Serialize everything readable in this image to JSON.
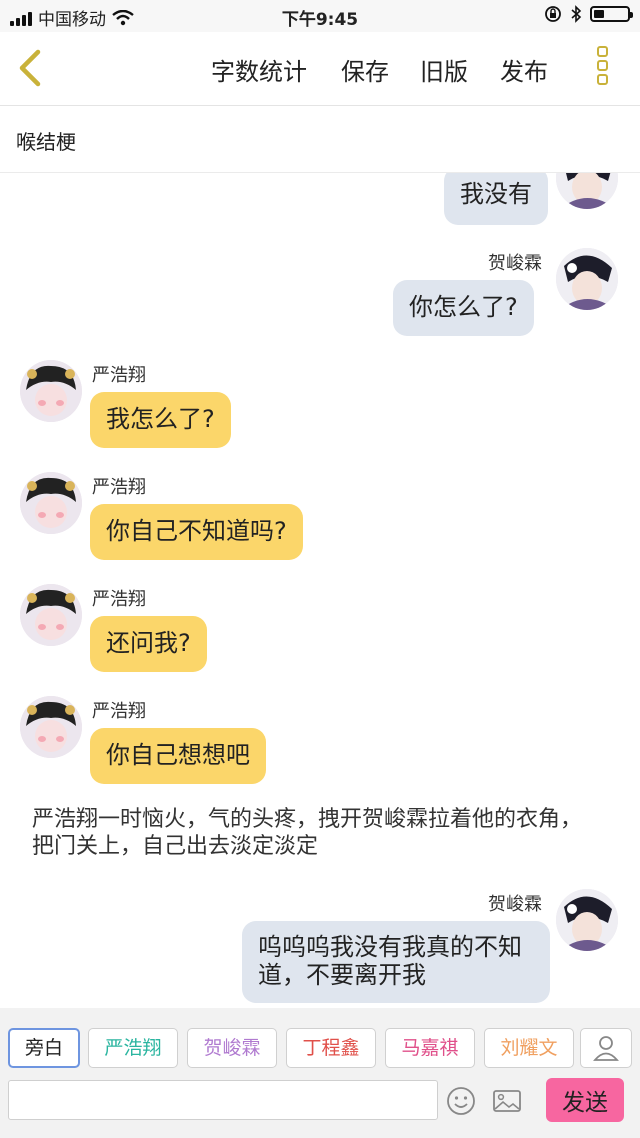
{
  "status_bar": {
    "carrier": "中国移动",
    "time": "下午9:45",
    "battery_level": 0.3
  },
  "nav": {
    "word_count": "字数统计",
    "save": "保存",
    "old_version": "旧版",
    "publish": "发布"
  },
  "title": "喉结梗",
  "messages": {
    "m1": {
      "text": "我没有"
    },
    "m2": {
      "name": "贺峻霖",
      "text": "你怎么了?"
    },
    "m3": {
      "name": "严浩翔",
      "text": "我怎么了?"
    },
    "m4": {
      "name": "严浩翔",
      "text": "你自己不知道吗?"
    },
    "m5": {
      "name": "严浩翔",
      "text": "还问我?"
    },
    "m6": {
      "name": "严浩翔",
      "text": "你自己想想吧"
    },
    "narration": "严浩翔一时恼火，气的头疼，拽开贺峻霖拉着他的衣角，把门关上，自己出去淡定淡定",
    "m7": {
      "name": "贺峻霖",
      "line1": "呜呜呜我没有我真的不知",
      "line2": "道，不要离开我"
    }
  },
  "roles": {
    "narration": {
      "label": "旁白"
    },
    "r1": {
      "label": "严浩翔",
      "color": "#2bb5a0"
    },
    "r2": {
      "label": "贺峻霖",
      "color": "#b07ad0"
    },
    "r3": {
      "label": "丁程鑫",
      "color": "#e0504a"
    },
    "r4": {
      "label": "马嘉祺",
      "color": "#e0508a"
    },
    "r5": {
      "label": "刘耀文",
      "color": "#f0a060"
    }
  },
  "input": {
    "value": "",
    "send": "发送"
  },
  "colors": {
    "left_bubble": "#fbd66a",
    "right_bubble": "#dfe5ee",
    "send_button": "#f766a0",
    "icon_accent": "#c9b23a"
  }
}
